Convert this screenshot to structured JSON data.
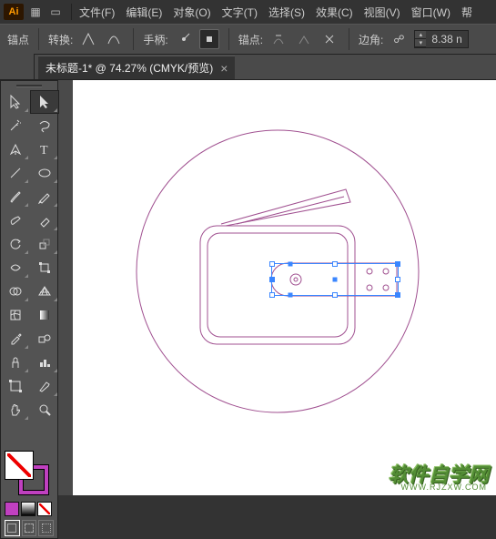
{
  "app": {
    "logo_text": "Ai"
  },
  "menu": {
    "file": "文件(F)",
    "edit": "编辑(E)",
    "object": "对象(O)",
    "type": "文字(T)",
    "select": "选择(S)",
    "effect": "效果(C)",
    "view": "视图(V)",
    "window": "窗口(W)",
    "help": "帮"
  },
  "controlbar": {
    "anchor_label": "锚点",
    "convert_label": "转换:",
    "handle_label": "手柄:",
    "anchors_label": "锚点:",
    "corner_label": "边角:",
    "corner_value": "8.38  n"
  },
  "tab": {
    "title": "未标题-1* @ 74.27% (CMYK/预览)",
    "close": "×"
  },
  "colors": {
    "artwork_stroke": "#a05090",
    "selection": "#3a86ff"
  },
  "watermark": {
    "main": "软件自学网",
    "sub": "WWW.RJZXW.COM"
  }
}
